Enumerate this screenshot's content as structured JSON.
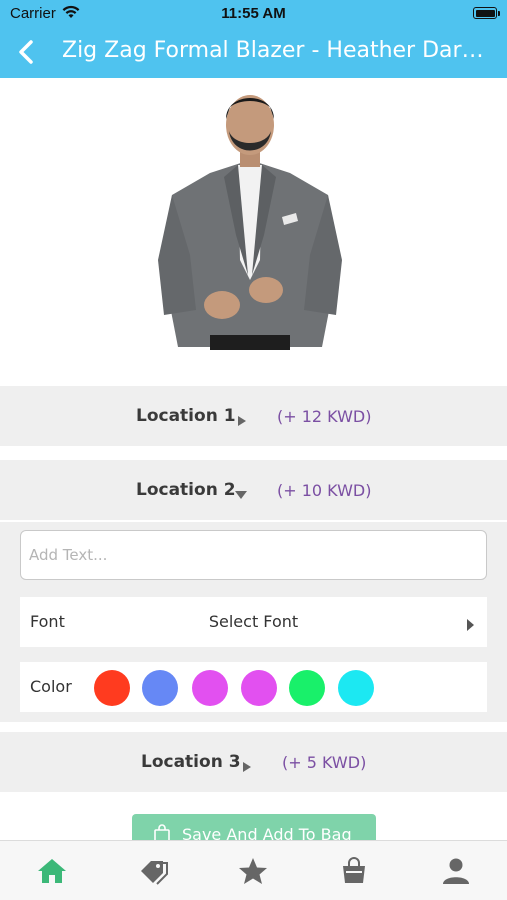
{
  "status_bar": {
    "carrier": "Carrier",
    "time": "11:55 AM"
  },
  "navbar": {
    "title": "Zig Zag Formal Blazer - Heather Dark Grey",
    "back_icon": "chevron-left-icon"
  },
  "product_image": {
    "description_icon": "product-photo"
  },
  "locations": [
    {
      "label": "Location 1",
      "price": "(+ 12 KWD)",
      "state": "collapsed"
    },
    {
      "label": "Location 2",
      "price": "(+ 10 KWD)",
      "state": "expanded"
    },
    {
      "label": "Location 3",
      "price": "(+ 5 KWD)",
      "state": "collapsed"
    }
  ],
  "customization": {
    "text_placeholder": "Add Text...",
    "text_value": "",
    "font_label": "Font",
    "font_value": "Select Font",
    "color_label": "Color",
    "colors": [
      "#ff3b1f",
      "#6688f5",
      "#e250f0",
      "#e250f0",
      "#19f06a",
      "#1ce8f2"
    ]
  },
  "cta": {
    "label": "Save And Add To Bag"
  },
  "tabbar": {
    "items": [
      {
        "icon": "home-icon",
        "color": "#3cb878"
      },
      {
        "icon": "tag-icon",
        "color": "#666666"
      },
      {
        "icon": "star-icon",
        "color": "#666666"
      },
      {
        "icon": "shopping-bag-icon",
        "color": "#666666"
      },
      {
        "icon": "user-icon",
        "color": "#666666"
      }
    ]
  }
}
